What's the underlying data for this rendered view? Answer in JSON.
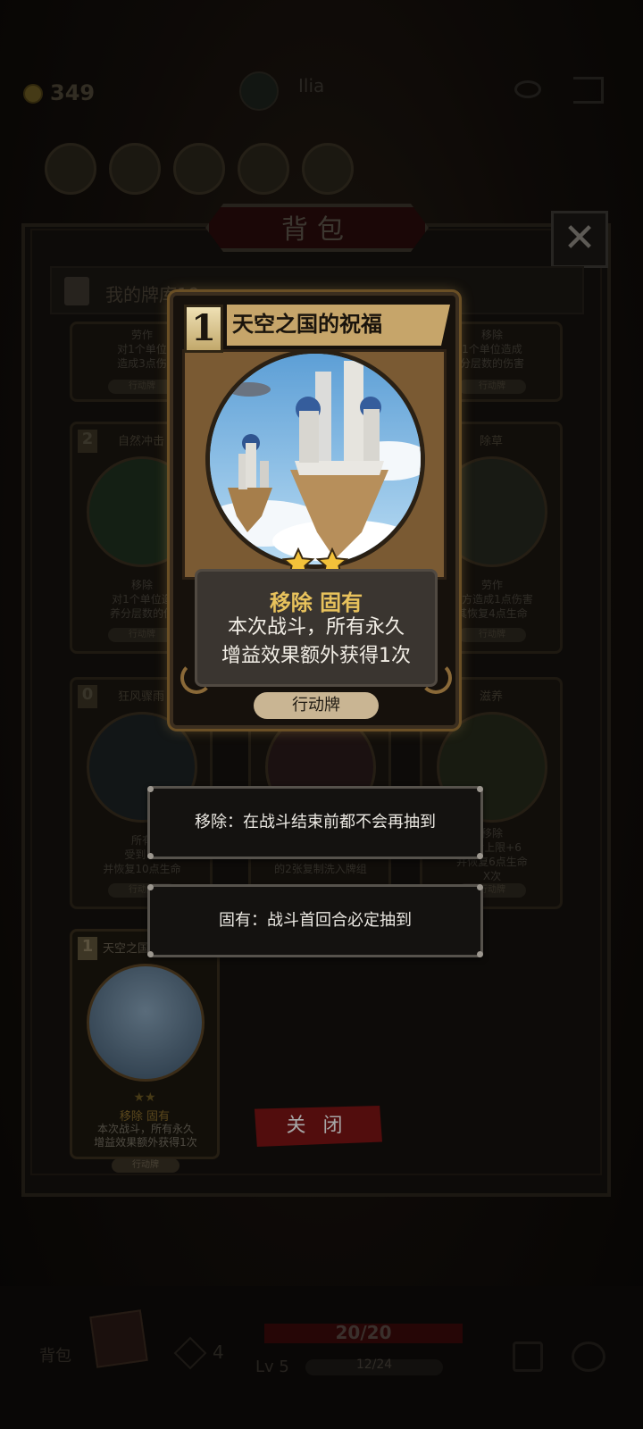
{
  "topbar": {
    "gold": "349",
    "player_name": "Ilia"
  },
  "bag": {
    "title": "背包",
    "close_symbol": "✕",
    "deck_label": "我的牌库19"
  },
  "background_cards": [
    {
      "cost": "",
      "name": "",
      "tags": "劳作",
      "desc": "对1个单位\n造成3点伤",
      "type": "行动牌"
    },
    {
      "cost": "",
      "name": "",
      "tags": "移除",
      "desc": "1个单位造成\n分层数的伤害",
      "type": "行动牌"
    },
    {
      "cost": "2",
      "name": "自然冲击",
      "tags": "移除",
      "desc": "对1个单位造\n养分层数的伤",
      "type": "行动牌"
    },
    {
      "cost": "",
      "name": "除草",
      "tags": "劳作",
      "desc": "友方造成1点伤害\n其恢复4点生命",
      "type": "行动牌"
    },
    {
      "cost": "0",
      "name": "狂风骤雨",
      "tags": "所有",
      "desc": "受到10\n并恢复10点生命",
      "type": "行动牌"
    },
    {
      "cost": "",
      "name": "",
      "tags": "",
      "desc": "的2张复制洗入牌组",
      "type": ""
    },
    {
      "cost": "",
      "name": "滋养",
      "tags": "移除",
      "desc": "生命上限+6\n并恢复6点生命\nX次",
      "type": "行动牌"
    }
  ],
  "bottom_card": {
    "cost": "1",
    "name": "天空之国",
    "stars": "★★",
    "tags": "移除 固有",
    "desc": "本次战斗，所有永久\n增益效果额外获得1次",
    "type": "行动牌"
  },
  "close_button": "关 闭",
  "bottombar": {
    "bag_label": "背包",
    "energy": "4",
    "hp": "20/20",
    "level": "Lv 5",
    "xp": "12/24"
  },
  "featured_card": {
    "cost": "1",
    "name": "天空之国的祝福",
    "stars": 2,
    "tags": "移除 固有",
    "desc_line1": "本次战斗，所有永久",
    "desc_line2": "增益效果额外获得1次",
    "type": "行动牌",
    "colors": {
      "frame": "#3b2e1f",
      "tags": "#e8c25c",
      "type_plate": "#c9b593"
    }
  },
  "tooltips": [
    {
      "text": "移除：在战斗结束前都不会再抽到"
    },
    {
      "text": "固有：战斗首回合必定抽到"
    }
  ]
}
